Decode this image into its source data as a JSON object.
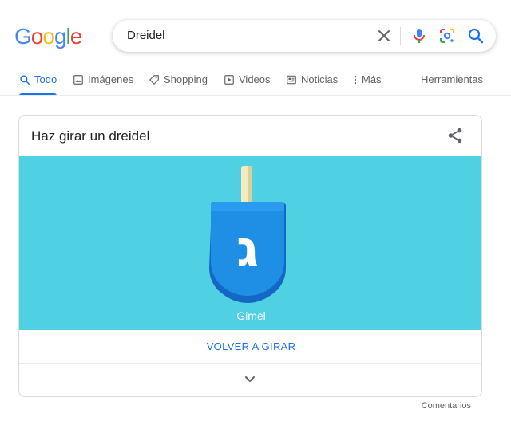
{
  "logo": {
    "letters": [
      "G",
      "o",
      "o",
      "g",
      "l",
      "e"
    ],
    "colors": [
      "#4285f4",
      "#ea4335",
      "#fbbc05",
      "#4285f4",
      "#34a853",
      "#ea4335"
    ]
  },
  "search": {
    "query": "Dreidel",
    "icons": [
      "close-icon",
      "microphone-icon",
      "lens-icon",
      "search-icon"
    ]
  },
  "tabs": [
    {
      "label": "Todo",
      "icon": "search-icon",
      "active": true
    },
    {
      "label": "Imágenes",
      "icon": "image-icon",
      "active": false
    },
    {
      "label": "Shopping",
      "icon": "tag-icon",
      "active": false
    },
    {
      "label": "Videos",
      "icon": "play-icon",
      "active": false
    },
    {
      "label": "Noticias",
      "icon": "news-icon",
      "active": false
    },
    {
      "label": "Más",
      "icon": "more-vert-icon",
      "active": false
    }
  ],
  "tools_label": "Herramientas",
  "card": {
    "title": "Haz girar un dreidel",
    "share_icon": "share-icon",
    "dreidel_letter": "ג",
    "result": "Gimel",
    "spin_again_label": "VOLVER A GIRAR",
    "expand_icon": "chevron-down-icon",
    "stage_color": "#4fd0e3",
    "dreidel_color": "#1f8fe6"
  },
  "feedback_label": "Comentarios",
  "colors": {
    "accent": "#1a73e8",
    "text_secondary": "#5f6368"
  }
}
